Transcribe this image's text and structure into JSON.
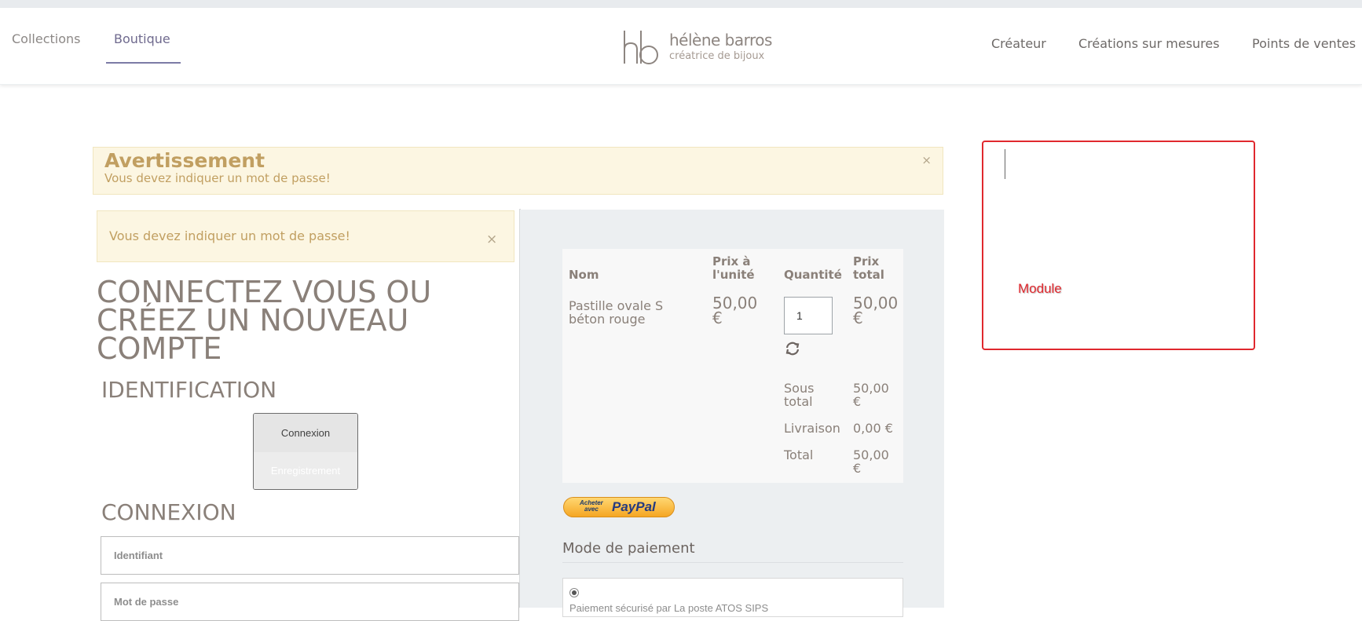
{
  "header": {
    "nav_left": [
      "Collections",
      "Boutique"
    ],
    "nav_right": [
      "Créateur",
      "Créations sur mesures",
      "Points de ventes"
    ],
    "logo": {
      "name": "hélène barros",
      "tagline": "créatrice de bijoux"
    }
  },
  "alert_top": {
    "title": "Avertissement",
    "message": "Vous devez indiquer un mot de passe!",
    "close": "×"
  },
  "alert_left": {
    "message": "Vous devez indiquer un mot de passe!",
    "close": "×"
  },
  "login": {
    "title": "CONNECTEZ VOUS OU CRÉEZ UN NOUVEAU COMPTE",
    "identification_heading": "IDENTIFICATION",
    "connexion_button": "Connexion",
    "register_button": "Enregistrement",
    "connexion_heading": "CONNEXION",
    "username_placeholder": "Identifiant",
    "password_placeholder": "Mot de passe"
  },
  "cart": {
    "headers": {
      "name": "Nom",
      "unit_price": "Prix à l'unité",
      "quantity": "Quantité",
      "total": "Prix total"
    },
    "item": {
      "name": "Pastille ovale S béton rouge",
      "unit_price": "50,00 €",
      "quantity": "1",
      "total": "50,00 €"
    },
    "subtotal_label": "Sous total",
    "subtotal_value": "50,00 €",
    "shipping_label": "Livraison",
    "shipping_value": "0,00 €",
    "total_label": "Total",
    "total_value": "50,00 €"
  },
  "paypal": {
    "small_text_1": "Acheter",
    "small_text_2": "avec",
    "logo_text": "PayPal"
  },
  "payment": {
    "title": "Mode de paiement",
    "option_label": "Paiement sécurisé par La poste ATOS SIPS"
  },
  "module": {
    "label": "Module"
  },
  "colors": {
    "accent": "#7c7ba6",
    "warning_bg": "#fcf6e2",
    "warning_text": "#c19f61",
    "module_border": "#e0282e"
  }
}
